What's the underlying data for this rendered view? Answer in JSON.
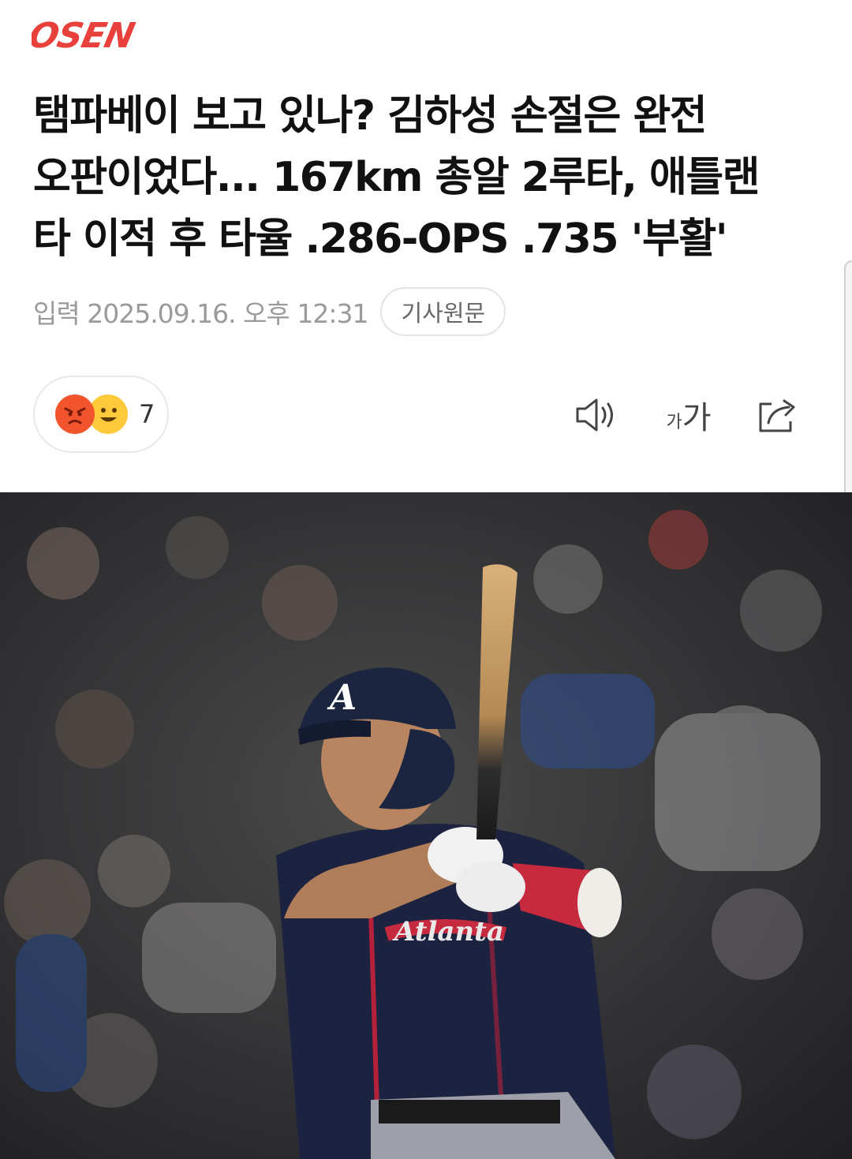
{
  "brand": {
    "logo_text": "OSEN",
    "logo_color": "#e8413c"
  },
  "article": {
    "headline_line1": "탬파베이 보고 있나? 김하성 손절은 완전",
    "headline_line2": "오판이었다... 167km 총알 2루타, 애틀랜",
    "headline_line3": "타 이적 후 타율 .286-OPS .735 '부활'",
    "published": "입력 2025.09.16. 오후 12:31",
    "original_link_label": "기사원문"
  },
  "reactions": {
    "count": "7",
    "emojis": [
      "angry-emoji-icon",
      "smile-emoji-icon"
    ]
  },
  "toolbar": {
    "audio_icon": "speaker-icon",
    "font_small": "가",
    "font_big": "가",
    "share_icon": "share-icon"
  },
  "photo": {
    "team_logo_letter": "A",
    "jersey_text": "Atlanta"
  }
}
